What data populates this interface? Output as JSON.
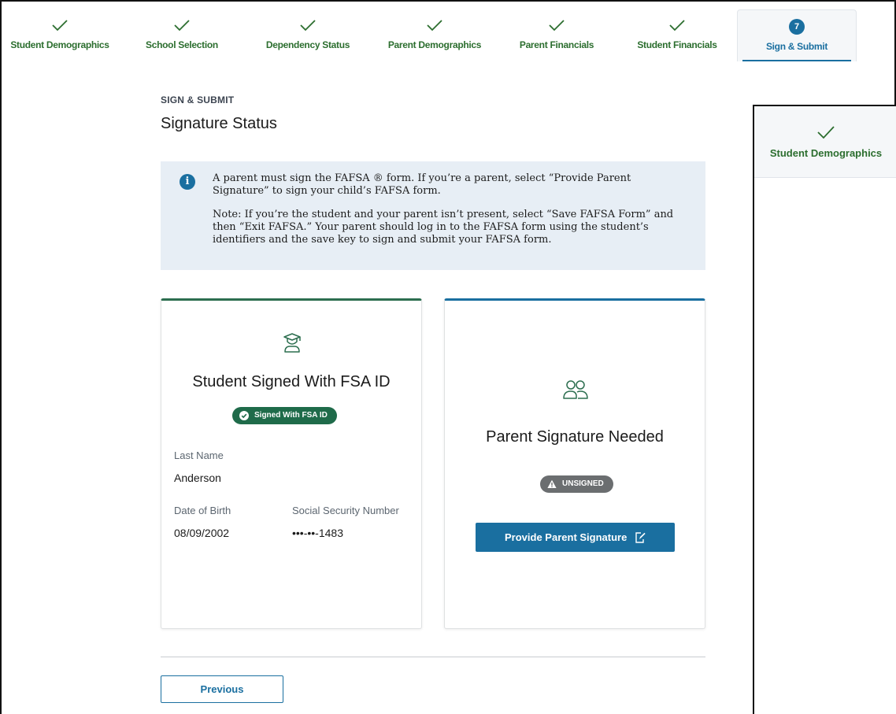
{
  "steps": [
    {
      "label": "Student Demographics",
      "status": "complete"
    },
    {
      "label": "School Selection",
      "status": "complete"
    },
    {
      "label": "Dependency Status",
      "status": "complete"
    },
    {
      "label": "Parent Demographics",
      "status": "complete"
    },
    {
      "label": "Parent Financials",
      "status": "complete"
    },
    {
      "label": "Student Financials",
      "status": "complete"
    },
    {
      "label": "Sign & Submit",
      "status": "current",
      "number": "7"
    }
  ],
  "page": {
    "eyebrow": "SIGN & SUBMIT",
    "title": "Signature Status"
  },
  "alert": {
    "p1": "A parent must sign the FAFSA ® form. If you’re a parent, select “Provide Parent Signature” to sign your child’s FAFSA form.",
    "p2": "Note: If you’re the student and your parent isn’t present, select “Save FAFSA Form” and then “Exit FAFSA.” Your parent should log in to the FAFSA form using the student’s identifiers and the save key to sign and submit your FAFSA form."
  },
  "student_card": {
    "title": "Student Signed With FSA ID",
    "badge": "Signed With FSA ID",
    "last_name_label": "Last Name",
    "last_name": "Anderson",
    "dob_label": "Date of Birth",
    "dob": "08/09/2002",
    "ssn_label": "Social Security Number",
    "ssn": "•••-••-1483"
  },
  "parent_card": {
    "title": "Parent Signature Needed",
    "badge": "UNSIGNED",
    "button": "Provide Parent Signature"
  },
  "nav": {
    "previous": "Previous"
  },
  "side_panel": {
    "label": "Student Demographics"
  },
  "colors": {
    "complete_green": "#2c6e2f",
    "primary_blue": "#1a6fa0",
    "signed_badge": "#1f6b4a",
    "unsigned_badge": "#6b6e70",
    "alert_bg": "#e7eef5"
  }
}
